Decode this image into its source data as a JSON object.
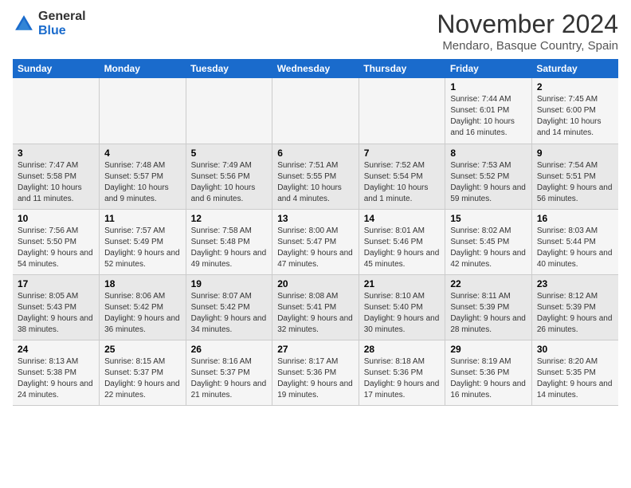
{
  "logo": {
    "line1": "General",
    "line2": "Blue"
  },
  "title": "November 2024",
  "location": "Mendaro, Basque Country, Spain",
  "days_of_week": [
    "Sunday",
    "Monday",
    "Tuesday",
    "Wednesday",
    "Thursday",
    "Friday",
    "Saturday"
  ],
  "weeks": [
    [
      {
        "day": "",
        "info": ""
      },
      {
        "day": "",
        "info": ""
      },
      {
        "day": "",
        "info": ""
      },
      {
        "day": "",
        "info": ""
      },
      {
        "day": "",
        "info": ""
      },
      {
        "day": "1",
        "info": "Sunrise: 7:44 AM\nSunset: 6:01 PM\nDaylight: 10 hours and 16 minutes."
      },
      {
        "day": "2",
        "info": "Sunrise: 7:45 AM\nSunset: 6:00 PM\nDaylight: 10 hours and 14 minutes."
      }
    ],
    [
      {
        "day": "3",
        "info": "Sunrise: 7:47 AM\nSunset: 5:58 PM\nDaylight: 10 hours and 11 minutes."
      },
      {
        "day": "4",
        "info": "Sunrise: 7:48 AM\nSunset: 5:57 PM\nDaylight: 10 hours and 9 minutes."
      },
      {
        "day": "5",
        "info": "Sunrise: 7:49 AM\nSunset: 5:56 PM\nDaylight: 10 hours and 6 minutes."
      },
      {
        "day": "6",
        "info": "Sunrise: 7:51 AM\nSunset: 5:55 PM\nDaylight: 10 hours and 4 minutes."
      },
      {
        "day": "7",
        "info": "Sunrise: 7:52 AM\nSunset: 5:54 PM\nDaylight: 10 hours and 1 minute."
      },
      {
        "day": "8",
        "info": "Sunrise: 7:53 AM\nSunset: 5:52 PM\nDaylight: 9 hours and 59 minutes."
      },
      {
        "day": "9",
        "info": "Sunrise: 7:54 AM\nSunset: 5:51 PM\nDaylight: 9 hours and 56 minutes."
      }
    ],
    [
      {
        "day": "10",
        "info": "Sunrise: 7:56 AM\nSunset: 5:50 PM\nDaylight: 9 hours and 54 minutes."
      },
      {
        "day": "11",
        "info": "Sunrise: 7:57 AM\nSunset: 5:49 PM\nDaylight: 9 hours and 52 minutes."
      },
      {
        "day": "12",
        "info": "Sunrise: 7:58 AM\nSunset: 5:48 PM\nDaylight: 9 hours and 49 minutes."
      },
      {
        "day": "13",
        "info": "Sunrise: 8:00 AM\nSunset: 5:47 PM\nDaylight: 9 hours and 47 minutes."
      },
      {
        "day": "14",
        "info": "Sunrise: 8:01 AM\nSunset: 5:46 PM\nDaylight: 9 hours and 45 minutes."
      },
      {
        "day": "15",
        "info": "Sunrise: 8:02 AM\nSunset: 5:45 PM\nDaylight: 9 hours and 42 minutes."
      },
      {
        "day": "16",
        "info": "Sunrise: 8:03 AM\nSunset: 5:44 PM\nDaylight: 9 hours and 40 minutes."
      }
    ],
    [
      {
        "day": "17",
        "info": "Sunrise: 8:05 AM\nSunset: 5:43 PM\nDaylight: 9 hours and 38 minutes."
      },
      {
        "day": "18",
        "info": "Sunrise: 8:06 AM\nSunset: 5:42 PM\nDaylight: 9 hours and 36 minutes."
      },
      {
        "day": "19",
        "info": "Sunrise: 8:07 AM\nSunset: 5:42 PM\nDaylight: 9 hours and 34 minutes."
      },
      {
        "day": "20",
        "info": "Sunrise: 8:08 AM\nSunset: 5:41 PM\nDaylight: 9 hours and 32 minutes."
      },
      {
        "day": "21",
        "info": "Sunrise: 8:10 AM\nSunset: 5:40 PM\nDaylight: 9 hours and 30 minutes."
      },
      {
        "day": "22",
        "info": "Sunrise: 8:11 AM\nSunset: 5:39 PM\nDaylight: 9 hours and 28 minutes."
      },
      {
        "day": "23",
        "info": "Sunrise: 8:12 AM\nSunset: 5:39 PM\nDaylight: 9 hours and 26 minutes."
      }
    ],
    [
      {
        "day": "24",
        "info": "Sunrise: 8:13 AM\nSunset: 5:38 PM\nDaylight: 9 hours and 24 minutes."
      },
      {
        "day": "25",
        "info": "Sunrise: 8:15 AM\nSunset: 5:37 PM\nDaylight: 9 hours and 22 minutes."
      },
      {
        "day": "26",
        "info": "Sunrise: 8:16 AM\nSunset: 5:37 PM\nDaylight: 9 hours and 21 minutes."
      },
      {
        "day": "27",
        "info": "Sunrise: 8:17 AM\nSunset: 5:36 PM\nDaylight: 9 hours and 19 minutes."
      },
      {
        "day": "28",
        "info": "Sunrise: 8:18 AM\nSunset: 5:36 PM\nDaylight: 9 hours and 17 minutes."
      },
      {
        "day": "29",
        "info": "Sunrise: 8:19 AM\nSunset: 5:36 PM\nDaylight: 9 hours and 16 minutes."
      },
      {
        "day": "30",
        "info": "Sunrise: 8:20 AM\nSunset: 5:35 PM\nDaylight: 9 hours and 14 minutes."
      }
    ]
  ]
}
